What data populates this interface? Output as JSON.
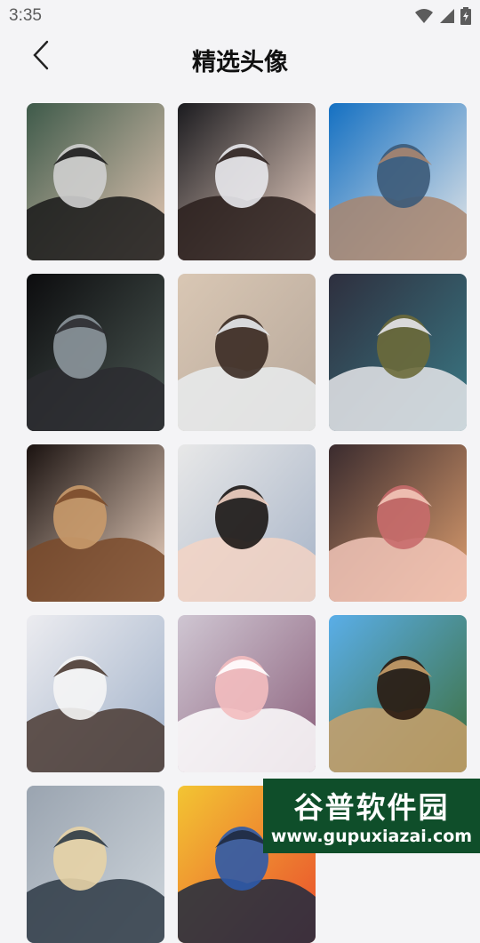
{
  "status_bar": {
    "time": "3:35",
    "icons": [
      "wifi-icon",
      "signal-icon",
      "battery-charging-icon"
    ]
  },
  "header": {
    "back_icon": "chevron-left-icon",
    "title": "精选头像"
  },
  "avatars": [
    {
      "id": "couple-selfie-mask",
      "palette": [
        "#3e5a4a",
        "#cfcfcf",
        "#1a1a1a",
        "#e7c9b6"
      ]
    },
    {
      "id": "couple-white-shirt",
      "palette": [
        "#1b1b1f",
        "#e8e8ec",
        "#2a1e1c",
        "#f0d6c8"
      ]
    },
    {
      "id": "blue-hoodie-face-cover",
      "palette": [
        "#1470c2",
        "#3c5a78",
        "#a88670",
        "#e8e8e8"
      ]
    },
    {
      "id": "car-window-silhouette",
      "palette": [
        "#0c0c0e",
        "#8c969c",
        "#2b2b30",
        "#4d5a55"
      ]
    },
    {
      "id": "boy-profile-dusk",
      "palette": [
        "#d9c7b4",
        "#3a2a22",
        "#e9ecef",
        "#b6a79a"
      ]
    },
    {
      "id": "blue-hair-white-hoodie",
      "palette": [
        "#2e2f3e",
        "#6b6a3a",
        "#e6e6ea",
        "#3a7a86"
      ]
    },
    {
      "id": "couple-hands-cheeks",
      "palette": [
        "#1a1210",
        "#c99a6a",
        "#7a4a2a",
        "#f1d7c4"
      ]
    },
    {
      "id": "couple-selfie-uniform",
      "palette": [
        "#e8e8e8",
        "#1b1614",
        "#f3d3c4",
        "#a6b3c7"
      ]
    },
    {
      "id": "anime-cat-girl-drink",
      "palette": [
        "#3a2b2e",
        "#c86c6c",
        "#f2c6b8",
        "#e0a070"
      ]
    },
    {
      "id": "girl-with-white-cat",
      "palette": [
        "#ececf0",
        "#f5f5f5",
        "#4a3a32",
        "#9fb0c8"
      ]
    },
    {
      "id": "anime-pink-hair-girl",
      "palette": [
        "#cfc6d2",
        "#f3bdbf",
        "#ffffff",
        "#8a5e7a"
      ]
    },
    {
      "id": "cartoon-pirate-usopp",
      "palette": [
        "#5aaee8",
        "#2a1a10",
        "#c9a06a",
        "#3d6e3a"
      ]
    },
    {
      "id": "blond-boy-partial",
      "palette": [
        "#9aa4b0",
        "#e7d3a6",
        "#2e3a45",
        "#cfd6dc"
      ]
    },
    {
      "id": "cartoon-blue-yellow-partial",
      "palette": [
        "#f3c533",
        "#2d5aa8",
        "#1f2a40",
        "#e94c2d"
      ]
    }
  ],
  "watermark": {
    "title": "谷普软件园",
    "url": "www.gupuxiazai.com"
  }
}
